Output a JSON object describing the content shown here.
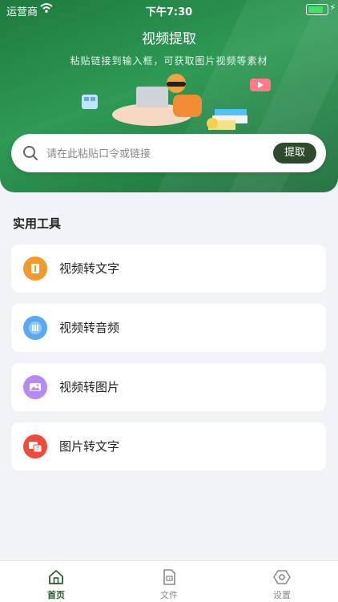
{
  "status_bar": {
    "carrier": "运营商",
    "time": "下午7:30"
  },
  "header": {
    "title": "视频提取",
    "subtitle": "粘贴链接到输入框，可获取图片视频等素材"
  },
  "search": {
    "placeholder": "请在此粘贴口令或链接",
    "button_label": "提取"
  },
  "tools": {
    "section_title": "实用工具",
    "items": [
      {
        "label": "视频转文字",
        "icon": "video-to-text-icon",
        "color": "#f39a2b"
      },
      {
        "label": "视频转音频",
        "icon": "video-to-audio-icon",
        "color": "#5aa9f0"
      },
      {
        "label": "视频转图片",
        "icon": "video-to-image-icon",
        "color": "#b58af2"
      },
      {
        "label": "图片转文字",
        "icon": "image-to-text-icon",
        "color": "#ef4a3a"
      }
    ]
  },
  "tabbar": {
    "tabs": [
      {
        "label": "首页",
        "icon": "home-icon",
        "active": true
      },
      {
        "label": "文件",
        "icon": "file-icon",
        "active": false
      },
      {
        "label": "设置",
        "icon": "settings-icon",
        "active": false
      }
    ]
  },
  "colors": {
    "brand_green": "#2e9a55",
    "button_dark": "#2e4a2c",
    "background": "#f2f3f7"
  }
}
